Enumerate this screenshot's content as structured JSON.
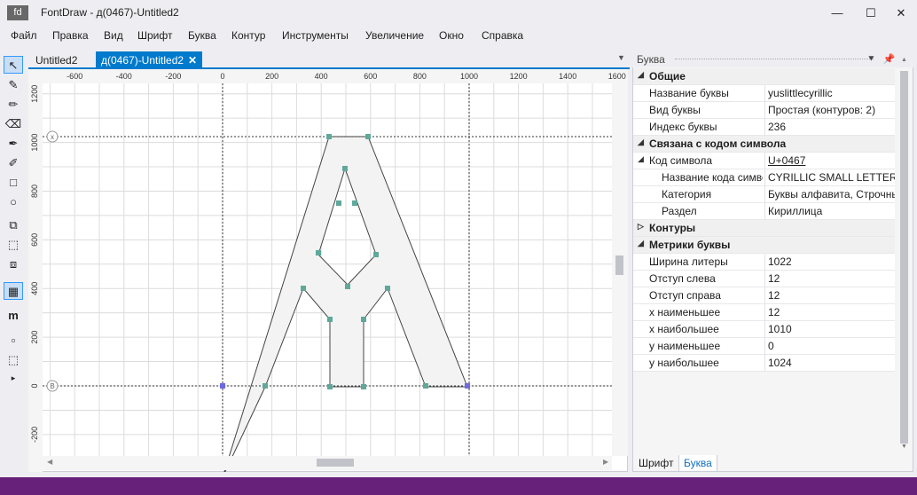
{
  "window": {
    "icon_text": "fd",
    "title": "FontDraw - д(0467)-Untitled2",
    "minimize": "—",
    "maximize": "☐",
    "close": "✕"
  },
  "menu": [
    "Файл",
    "Правка",
    "Вид",
    "Шрифт",
    "Буква",
    "Контур",
    "Инструменты",
    "Увеличение",
    "Окно",
    "Справка"
  ],
  "tools": [
    "pointer-icon",
    "pen-icon",
    "pencil-icon",
    "eraser-icon",
    "brush-icon",
    "calligraphy-pen-icon",
    "rectangle-icon",
    "ellipse-icon",
    "union-icon",
    "select-area-icon",
    "overlap-icon",
    "grid-icon",
    "m-glyph-icon",
    "panel-icon",
    "fit-icon",
    "more-icon"
  ],
  "tool_glyphs": [
    "↖",
    "✎",
    "✏",
    "⌫",
    "✒",
    "✐",
    "□",
    "○",
    "⧉",
    "⬚",
    "⧈",
    "▦",
    "m",
    "▫",
    "⬚",
    "▸"
  ],
  "doc_tabs": [
    {
      "label": "Untitled2"
    },
    {
      "label": "д(0467)-Untitled2",
      "close": "✕"
    }
  ],
  "tabs_dropdown": "▼",
  "ruler_x": [
    "-600",
    "-400",
    "-200",
    "0",
    "200",
    "400",
    "600",
    "800",
    "1000",
    "1200",
    "1400",
    "1600"
  ],
  "ruler_y": [
    "1200",
    "1000",
    "800",
    "600",
    "400",
    "200",
    "0",
    "-200"
  ],
  "guide_markers": {
    "x": "x",
    "b": "B"
  },
  "panel": {
    "title": "Буква",
    "pin": "⯆ 📌 ✕",
    "rows": [
      {
        "type": "cat",
        "expander": "◢",
        "name": "Общие"
      },
      {
        "type": "prop",
        "name": "Название буквы",
        "value": "yuslittlecyrillic"
      },
      {
        "type": "prop",
        "name": "Вид буквы",
        "value": "Простая (контуров: 2)"
      },
      {
        "type": "prop",
        "name": "Индекс буквы",
        "value": "236"
      },
      {
        "type": "cat",
        "expander": "◢",
        "name": "Связана с кодом символа"
      },
      {
        "type": "prop",
        "expander": "◢",
        "name": "Код символа",
        "value": "U+0467",
        "link": true
      },
      {
        "type": "sub",
        "name": "Название кода симво",
        "value": "CYRILLIC SMALL LETTER LITTLE YUS"
      },
      {
        "type": "sub",
        "name": "Категория",
        "value": "Буквы алфавита, Строчные"
      },
      {
        "type": "sub",
        "name": "Раздел",
        "value": "Кириллица"
      },
      {
        "type": "cat",
        "expander": "▷",
        "name": "Контуры"
      },
      {
        "type": "cat",
        "expander": "◢",
        "name": "Метрики буквы"
      },
      {
        "type": "prop",
        "name": "Ширина литеры",
        "value": "1022"
      },
      {
        "type": "prop",
        "name": "Отступ слева",
        "value": "12"
      },
      {
        "type": "prop",
        "name": "Отступ справа",
        "value": "12"
      },
      {
        "type": "prop",
        "name": "x наименьшее",
        "value": "12"
      },
      {
        "type": "prop",
        "name": "x наибольшее",
        "value": "1010"
      },
      {
        "type": "prop",
        "name": "y наименьшее",
        "value": "0"
      },
      {
        "type": "prop",
        "name": "y наибольшее",
        "value": "1024"
      }
    ],
    "tabs": [
      "Шрифт",
      "Буква"
    ]
  },
  "colors": {
    "accent": "#007acc",
    "status": "#68217a",
    "guide": "#333333",
    "node": "#5fa89a",
    "node_selected": "#6b6bdf"
  }
}
